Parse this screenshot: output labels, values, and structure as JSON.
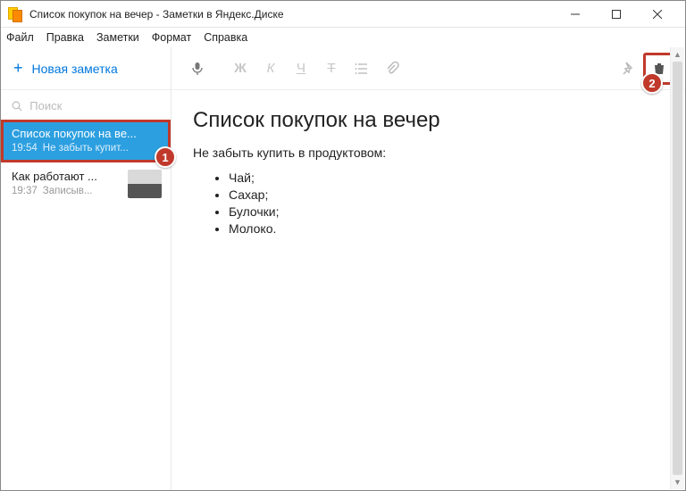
{
  "window": {
    "title": "Список покупок на вечер - Заметки в Яндекс.Диске"
  },
  "menu": {
    "file": "Файл",
    "edit": "Правка",
    "notes": "Заметки",
    "format": "Формат",
    "help": "Справка"
  },
  "sidebar": {
    "new_note_label": "Новая заметка",
    "search_placeholder": "Поиск",
    "notes": [
      {
        "title": "Список покупок на ве...",
        "time": "19:54",
        "preview": "Не забыть купит...",
        "selected": true
      },
      {
        "title": "Как работают ...",
        "time": "19:37",
        "preview": "Записыв...",
        "selected": false,
        "has_thumb": true
      }
    ]
  },
  "toolbar": {
    "bold": "Ж",
    "italic": "К",
    "underline": "Ч",
    "strike": "Т"
  },
  "note": {
    "title": "Список покупок на вечер",
    "lead": "Не забыть купить в продуктовом:",
    "items": [
      "Чай;",
      "Сахар;",
      "Булочки;",
      "Молоко."
    ]
  },
  "callouts": {
    "one": "1",
    "two": "2"
  }
}
